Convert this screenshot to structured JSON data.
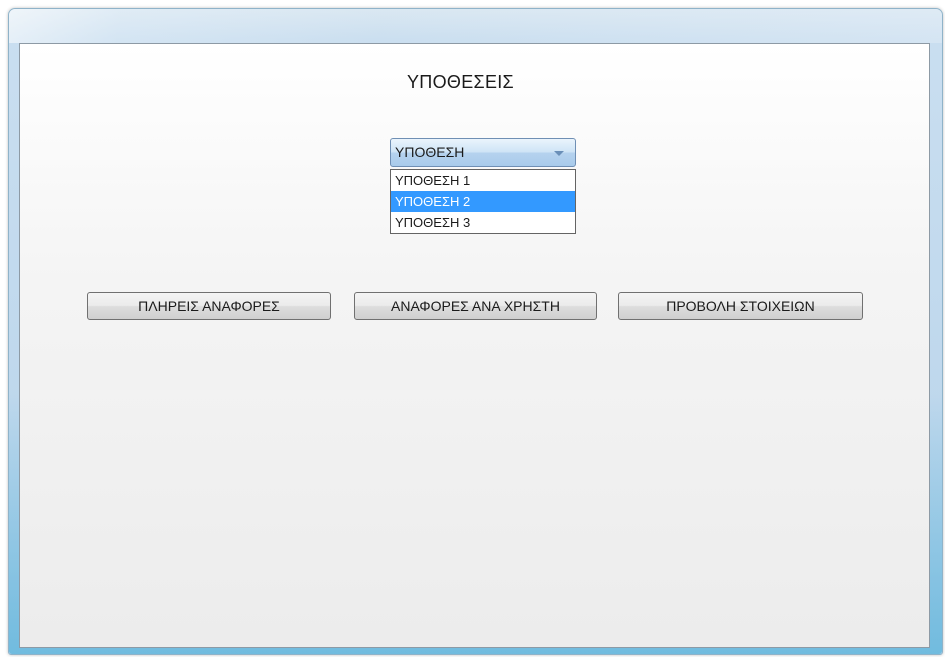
{
  "page": {
    "title": "ΥΠΟΘΕΣΕΙΣ"
  },
  "case_select": {
    "value": "ΥΠΟΘΕΣΗ",
    "options": [
      "ΥΠΟΘΕΣΗ 1",
      "ΥΠΟΘΕΣΗ 2",
      "ΥΠΟΘΕΣΗ 3"
    ],
    "highlighted_index": 1
  },
  "actions": {
    "full_reports_label": "ΠΛΗΡΕΙΣ ΑΝΑΦΟΡΕΣ",
    "reports_per_user_label": "ΑΝΑΦΟΡΕΣ ΑΝΑ ΧΡΗΣΤΗ",
    "view_details_label": "ΠΡΟΒΟΛΗ ΣΤΟΙΧΕΙΩΝ"
  },
  "colors": {
    "highlight": "#3399ff",
    "frame_accent": "#6dbade"
  }
}
